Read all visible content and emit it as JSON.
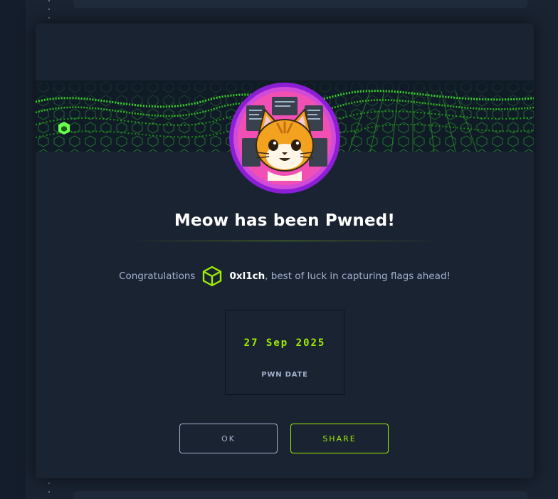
{
  "modal": {
    "title": "Meow has been Pwned!",
    "congrats_prefix": "Congratulations",
    "username": "0xl1ch",
    "congrats_suffix": ", best of luck in capturing flags ahead!",
    "pwn_date": "27 Sep 2025",
    "pwn_date_label": "PWN DATE",
    "ok_label": "OK",
    "share_label": "SHARE",
    "icons": {
      "avatar": "meow-cat-avatar",
      "user_badge": "hexagon-cube-icon",
      "banner": "green-wave-banner"
    }
  },
  "colors": {
    "accent": "#9fef00",
    "background": "#141d2b",
    "panel": "#1a2332",
    "avatar_ring": "#9f2bdb",
    "muted_text": "#a4b1cd"
  }
}
